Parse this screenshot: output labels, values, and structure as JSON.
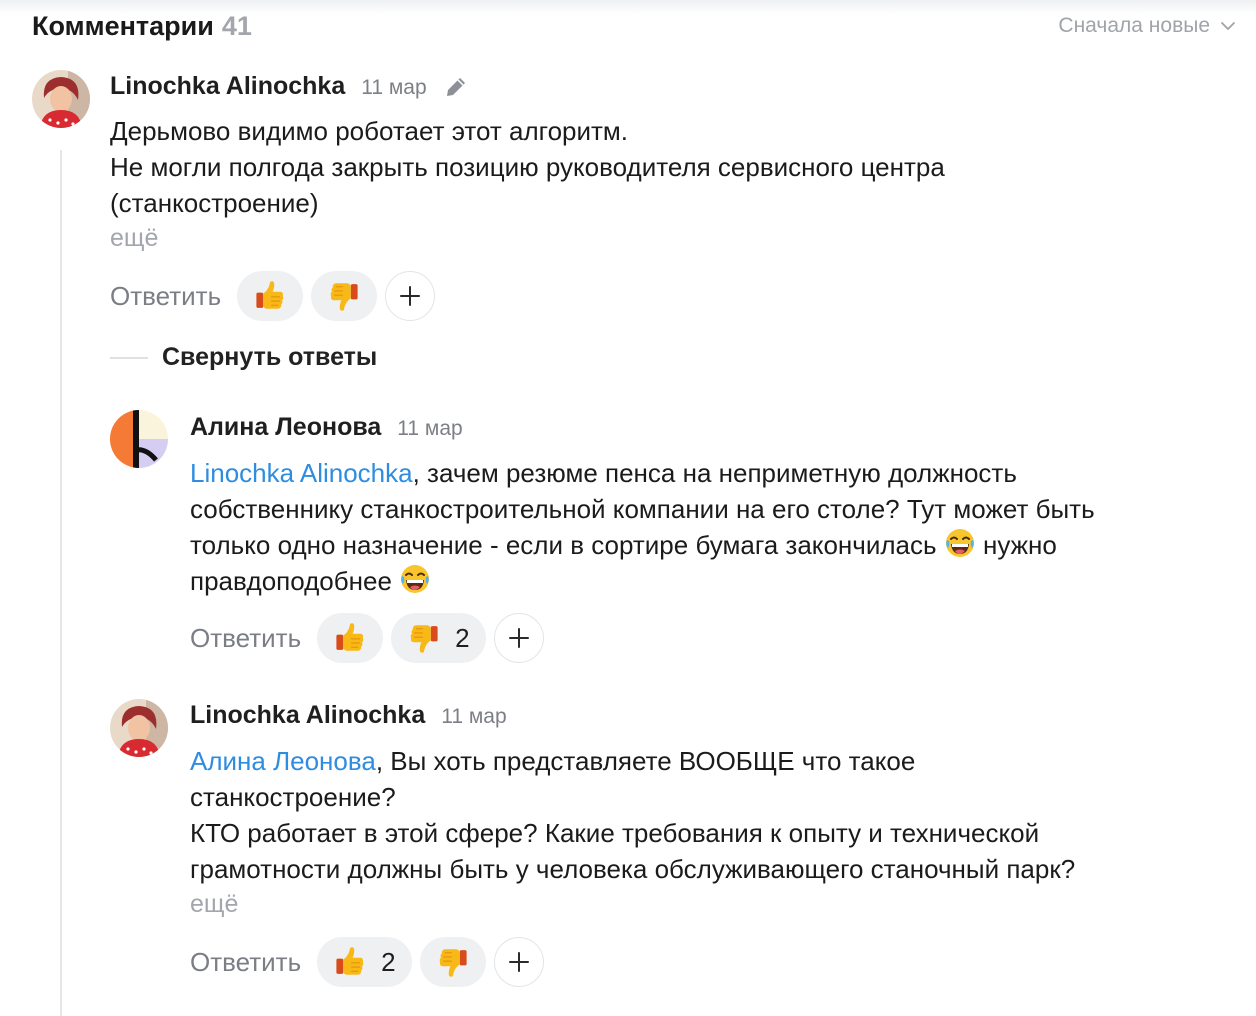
{
  "header": {
    "title": "Комментарии",
    "count": "41",
    "sort_label": "Сначала новые"
  },
  "comments": [
    {
      "author": "Linochka Alinochka",
      "date": "11 мар",
      "lines": [
        "Дерьмово видимо роботает этот алгоритм.",
        "Не могли полгода закрыть позицию руководителя сервисного центра",
        "(станкостроение)"
      ],
      "more": "ещё",
      "reply": "Ответить",
      "likes": "",
      "dislikes": ""
    },
    {
      "author": "Алина Леонова",
      "date": "11 мар",
      "mention": "Linochka Alinochka",
      "line1_rest": ", зачем резюме пенса на неприметную должность",
      "line2": "собственнику станкостроительной компании на его столе? Тут может быть",
      "line3_a": "только одно назначение - если в сортире бумага закончилась",
      "line3_b": "нужно",
      "line4": "правдоподобнее",
      "reply": "Ответить",
      "likes": "",
      "dislikes": "2"
    },
    {
      "author": "Linochka Alinochka",
      "date": "11 мар",
      "mention": "Алина Леонова",
      "line1_rest": ", Вы хоть представляете ВООБЩЕ что такое",
      "line2": "станкостроение?",
      "line3": "КТО работает в этой сфере? Какие требования к опыту и технической",
      "line4": "грамотности должны быть у человека обслуживающего станочный парк?",
      "more": "ещё",
      "reply": "Ответить",
      "likes": "2",
      "dislikes": ""
    }
  ],
  "collapse_label": "Свернуть ответы",
  "icons": {
    "sort": "chevron-down-icon",
    "edit": "pencil-icon",
    "like": "thumbs-up-icon",
    "dislike": "thumbs-down-icon",
    "add": "plus-icon",
    "laugh": "laughing-emoji-icon"
  },
  "colors": {
    "mention": "#2e8de0",
    "muted": "#7b7e84",
    "reaction_bg": "#eff0f2"
  }
}
